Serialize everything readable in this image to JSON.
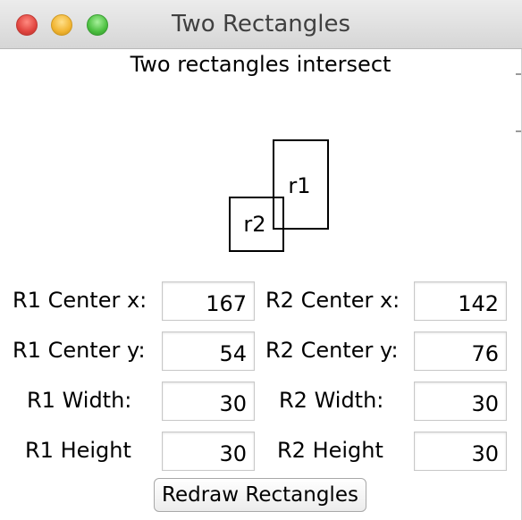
{
  "window": {
    "title": "Two Rectangles"
  },
  "heading": "Two rectangles intersect",
  "canvas": {
    "r1_label": "r1",
    "r2_label": "r2"
  },
  "fields": {
    "r1_center_x": {
      "label": "R1 Center x:",
      "value": "167"
    },
    "r1_center_y": {
      "label": "R1 Center y:",
      "value": "54"
    },
    "r1_width": {
      "label": "R1 Width:",
      "value": "30"
    },
    "r1_height": {
      "label": "R1 Height",
      "value": "30"
    },
    "r2_center_x": {
      "label": "R2 Center x:",
      "value": "142"
    },
    "r2_center_y": {
      "label": "R2 Center y:",
      "value": "76"
    },
    "r2_width": {
      "label": "R2 Width:",
      "value": "30"
    },
    "r2_height": {
      "label": "R2 Height",
      "value": "30"
    }
  },
  "buttons": {
    "redraw_label": "Redraw Rectangles"
  }
}
